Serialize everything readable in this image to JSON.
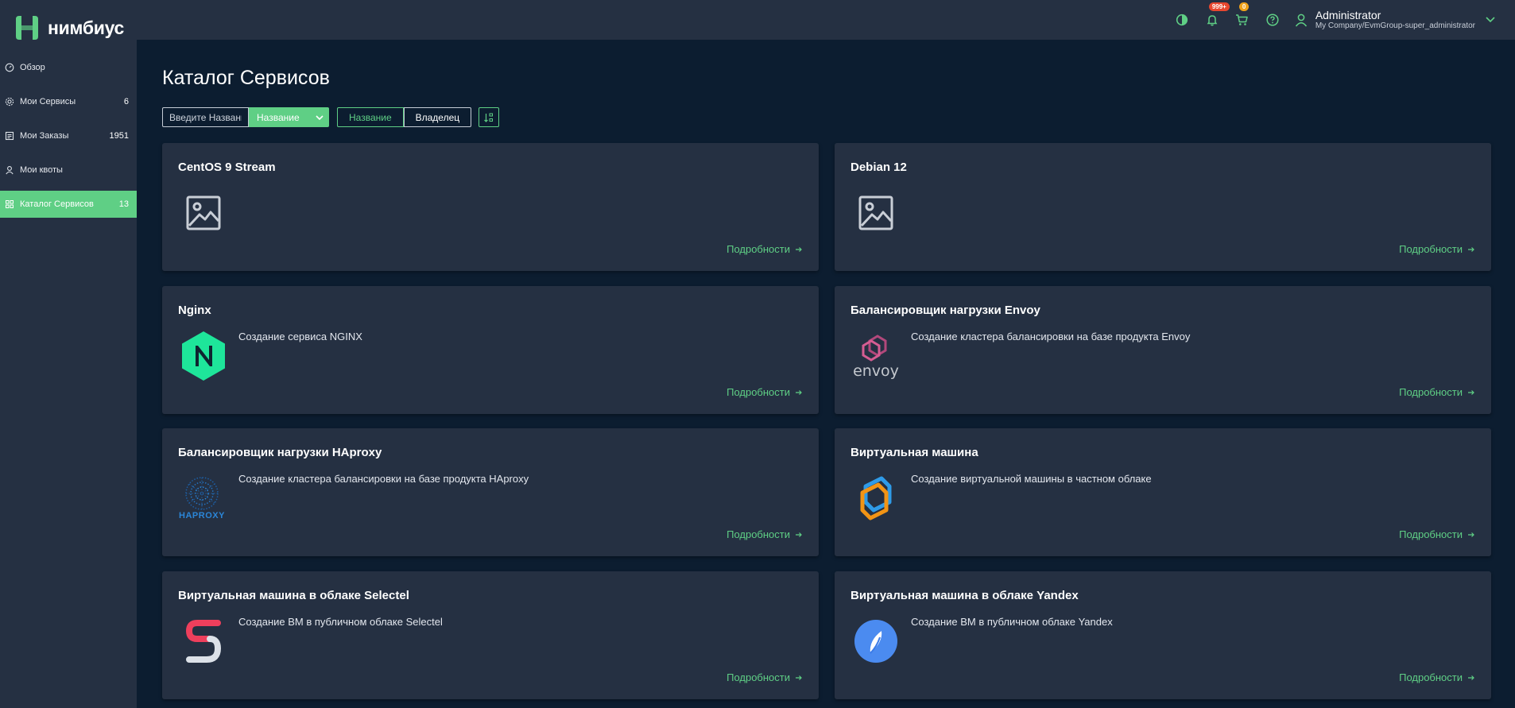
{
  "brand": {
    "name": "нимбиус",
    "accent": "#5fcf85"
  },
  "sidebar": {
    "items": [
      {
        "label": "Обзор",
        "count": "",
        "icon": "dashboard-icon",
        "active": false
      },
      {
        "label": "Мои Сервисы",
        "count": "6",
        "icon": "gear-icon",
        "active": false
      },
      {
        "label": "Мои Заказы",
        "count": "1951",
        "icon": "orders-icon",
        "active": false
      },
      {
        "label": "Мои квоты",
        "count": "",
        "icon": "user-icon",
        "active": false
      },
      {
        "label": "Каталог Сервисов",
        "count": "13",
        "icon": "grid-icon",
        "active": true
      }
    ]
  },
  "header": {
    "notifications_badge": "999+",
    "cart_badge": "0",
    "user_name": "Administrator",
    "user_org": "My Company/EvmGroup-super_administrator"
  },
  "main": {
    "title": "Каталог Сервисов",
    "search_placeholder": "Введите Название",
    "field_select": "Название",
    "sort_options": [
      "Название",
      "Владелец"
    ],
    "details_label": "Подробности"
  },
  "cards": [
    {
      "title": "CentOS 9 Stream",
      "description": "",
      "logo": "image-placeholder-icon"
    },
    {
      "title": "Debian 12",
      "description": "",
      "logo": "image-placeholder-icon"
    },
    {
      "title": "Nginx",
      "description": "Создание сервиса NGINX",
      "logo": "nginx-logo"
    },
    {
      "title": "Балансировщик нагрузки Envoy",
      "description": "Создание кластера балансировки на базе продукта Envoy",
      "logo": "envoy-logo"
    },
    {
      "title": "Балансировщик нагрузки HAproxy",
      "description": "Создание кластера балансировки на базе продукта HAproxy",
      "logo": "haproxy-logo"
    },
    {
      "title": "Виртуальная машина",
      "description": "Создание виртуальной машины в частном облаке",
      "logo": "vm-logo"
    },
    {
      "title": "Виртуальная машина в облаке Selectel",
      "description": "Создание ВМ в публичном облаке Selectel",
      "logo": "selectel-logo"
    },
    {
      "title": "Виртуальная машина в облаке Yandex",
      "description": "Создание ВМ в публичном облаке Yandex",
      "logo": "yandex-cloud-logo"
    }
  ],
  "logo_text": {
    "envoy": "envoy",
    "haproxy": "HAPROXY"
  }
}
